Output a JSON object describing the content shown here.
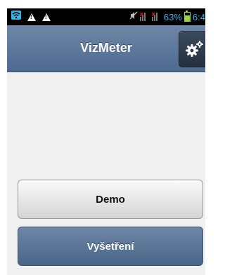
{
  "status_bar": {
    "battery_percent": "63%",
    "battery_level": 0.63,
    "clock": "6:4",
    "icons": [
      "wifi-icon",
      "warning-icon",
      "warning-icon",
      "mute-icon",
      "no-signal-icon",
      "no-signal-icon",
      "battery-icon"
    ]
  },
  "header": {
    "title": "VizMeter",
    "settings_icon": "gear-icon"
  },
  "buttons": {
    "demo_label": "Demo",
    "exam_label": "Vyšetření"
  },
  "colors": {
    "header": "#5b7597",
    "primary_button": "#5b7597",
    "secondary_button": "#e6e6e6",
    "background": "#f0f0f0",
    "accent_status": "#35b5e5"
  }
}
